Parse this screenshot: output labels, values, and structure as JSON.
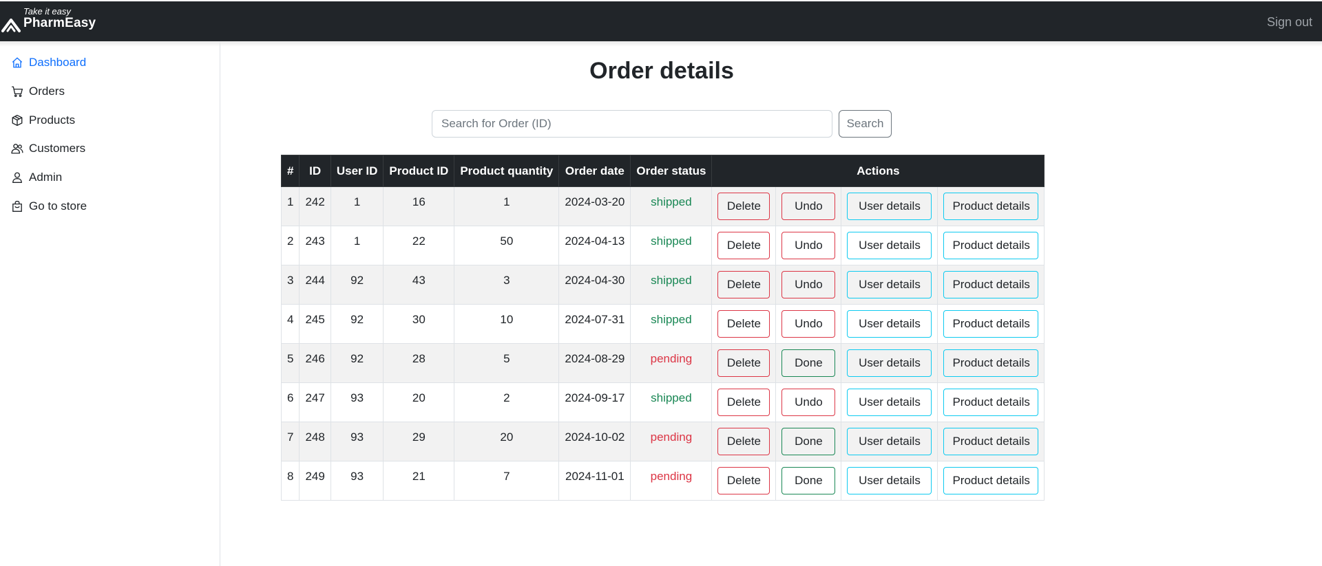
{
  "brand": {
    "tagline": "Take it easy",
    "name": "PharmEasy"
  },
  "header": {
    "signout_label": "Sign out"
  },
  "sidebar": {
    "items": [
      {
        "label": "Dashboard",
        "icon": "home-icon",
        "active": true
      },
      {
        "label": "Orders",
        "icon": "cart-icon",
        "active": false
      },
      {
        "label": "Products",
        "icon": "box-icon",
        "active": false
      },
      {
        "label": "Customers",
        "icon": "people-icon",
        "active": false
      },
      {
        "label": "Admin",
        "icon": "person-icon",
        "active": false
      },
      {
        "label": "Go to store",
        "icon": "bag-icon",
        "active": false
      }
    ]
  },
  "main": {
    "title": "Order details",
    "search": {
      "placeholder": "Search for Order (ID)",
      "value": "",
      "button_label": "Search"
    },
    "table": {
      "headers": [
        "#",
        "ID",
        "User ID",
        "Product ID",
        "Product quantity",
        "Order date",
        "Order status",
        "Actions"
      ],
      "rows": [
        {
          "num": "1",
          "id": "242",
          "user_id": "1",
          "product_id": "16",
          "quantity": "1",
          "date": "2024-03-20",
          "status": "shipped",
          "toggle_label": "Undo"
        },
        {
          "num": "2",
          "id": "243",
          "user_id": "1",
          "product_id": "22",
          "quantity": "50",
          "date": "2024-04-13",
          "status": "shipped",
          "toggle_label": "Undo"
        },
        {
          "num": "3",
          "id": "244",
          "user_id": "92",
          "product_id": "43",
          "quantity": "3",
          "date": "2024-04-30",
          "status": "shipped",
          "toggle_label": "Undo"
        },
        {
          "num": "4",
          "id": "245",
          "user_id": "92",
          "product_id": "30",
          "quantity": "10",
          "date": "2024-07-31",
          "status": "shipped",
          "toggle_label": "Undo"
        },
        {
          "num": "5",
          "id": "246",
          "user_id": "92",
          "product_id": "28",
          "quantity": "5",
          "date": "2024-08-29",
          "status": "pending",
          "toggle_label": "Done"
        },
        {
          "num": "6",
          "id": "247",
          "user_id": "93",
          "product_id": "20",
          "quantity": "2",
          "date": "2024-09-17",
          "status": "shipped",
          "toggle_label": "Undo"
        },
        {
          "num": "7",
          "id": "248",
          "user_id": "93",
          "product_id": "29",
          "quantity": "20",
          "date": "2024-10-02",
          "status": "pending",
          "toggle_label": "Done"
        },
        {
          "num": "8",
          "id": "249",
          "user_id": "93",
          "product_id": "21",
          "quantity": "7",
          "date": "2024-11-01",
          "status": "pending",
          "toggle_label": "Done"
        }
      ],
      "actions": {
        "delete_label": "Delete",
        "user_details_label": "User details",
        "product_details_label": "Product details"
      }
    }
  },
  "colors": {
    "topbar": "#212529",
    "active_link": "#0d6efd",
    "shipped": "#198754",
    "pending": "#dc3545",
    "danger_border": "#dc3545",
    "success_border": "#198754",
    "info_border": "#0dcaf0"
  }
}
